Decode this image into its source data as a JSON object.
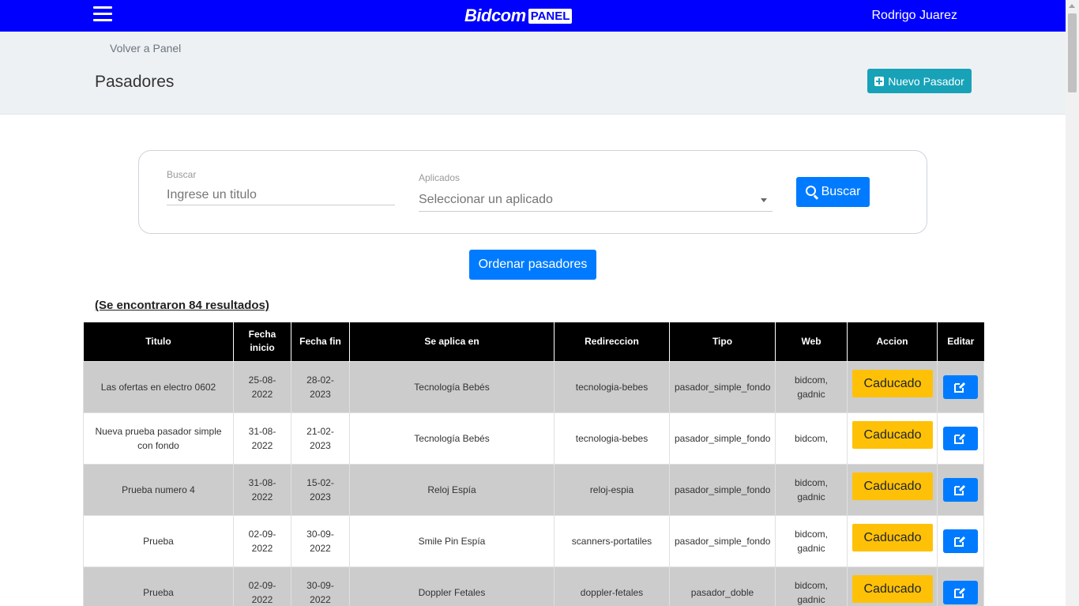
{
  "header": {
    "logo_text": "Bidcom",
    "logo_badge": "PANEL",
    "user_name": "Rodrigo Juarez"
  },
  "subheader": {
    "back_link": "Volver a Panel",
    "page_title": "Pasadores",
    "new_button_label": "Nuevo Pasador"
  },
  "search": {
    "buscar_label": "Buscar",
    "buscar_placeholder": "Ingrese un titulo",
    "aplicados_label": "Aplicados",
    "aplicados_placeholder": "Seleccionar un aplicado",
    "search_button_label": "Buscar"
  },
  "sort_button_label": "Ordenar pasadores",
  "results_text": "(Se encontraron 84 resultados)",
  "table": {
    "columns": [
      "Titulo",
      "Fecha inicio",
      "Fecha fin",
      "Se aplica en",
      "Redireccion",
      "Tipo",
      "Web",
      "Accion",
      "Editar"
    ],
    "rows": [
      {
        "titulo": "Las ofertas en electro 0602",
        "fecha_inicio": "25-08-2022",
        "fecha_fin": "28-02-2023",
        "aplica_en": "Tecnología Bebés",
        "redireccion": "tecnologia-bebes",
        "tipo": "pasador_simple_fondo",
        "web": "bidcom, gadnic",
        "accion": "Caducado"
      },
      {
        "titulo": "Nueva prueba pasador simple con fondo",
        "fecha_inicio": "31-08-2022",
        "fecha_fin": "21-02-2023",
        "aplica_en": "Tecnología Bebés",
        "redireccion": "tecnologia-bebes",
        "tipo": "pasador_simple_fondo",
        "web": "bidcom,",
        "accion": "Caducado"
      },
      {
        "titulo": "Prueba numero 4",
        "fecha_inicio": "31-08-2022",
        "fecha_fin": "15-02-2023",
        "aplica_en": "Reloj Espía",
        "redireccion": "reloj-espia",
        "tipo": "pasador_simple_fondo",
        "web": "bidcom, gadnic",
        "accion": "Caducado"
      },
      {
        "titulo": "Prueba",
        "fecha_inicio": "02-09-2022",
        "fecha_fin": "30-09-2022",
        "aplica_en": "Smile Pin Espía",
        "redireccion": "scanners-portatiles",
        "tipo": "pasador_simple_fondo",
        "web": "bidcom, gadnic",
        "accion": "Caducado"
      },
      {
        "titulo": "Prueba",
        "fecha_inicio": "02-09-2022",
        "fecha_fin": "30-09-2022",
        "aplica_en": "Doppler Fetales",
        "redireccion": "doppler-fetales",
        "tipo": "pasador_doble",
        "web": "bidcom, gadnic",
        "accion": "Caducado"
      }
    ]
  },
  "colors": {
    "topbar": "#0000ff",
    "primary": "#007bff",
    "info": "#17a2b8",
    "warning": "#ffc107",
    "row_shade": "#cccccc"
  },
  "icons": {
    "menu": "hamburger-icon",
    "new": "plus-square-icon",
    "search": "search-icon",
    "edit": "edit-icon"
  }
}
